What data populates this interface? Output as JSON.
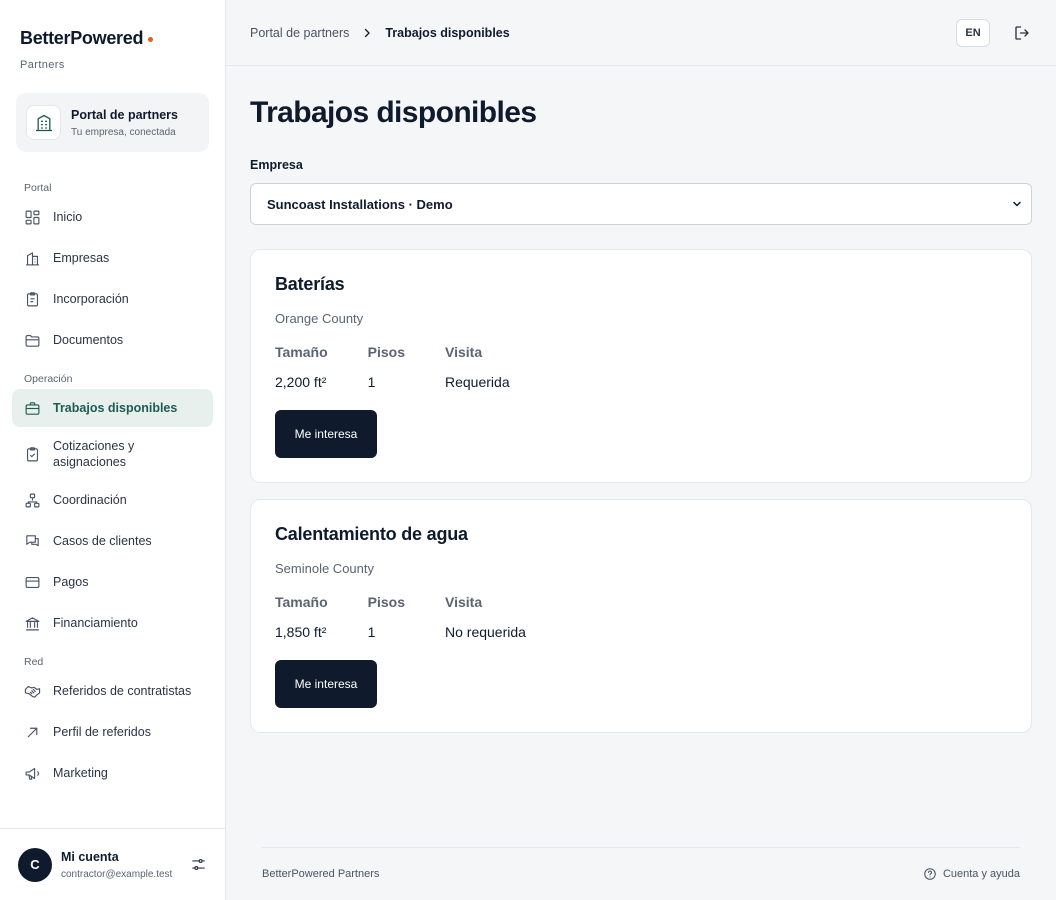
{
  "brand": {
    "name": "BetterPowered",
    "sub": "Partners",
    "dot_color": "#e0601e"
  },
  "portal_card": {
    "title": "Portal de partners",
    "subtitle": "Tu empresa, conectada",
    "icon": "building-icon"
  },
  "nav": {
    "sections": [
      {
        "label": "Portal",
        "items": [
          {
            "label": "Inicio",
            "icon": "dashboard-icon"
          },
          {
            "label": "Empresas",
            "icon": "building-icon"
          },
          {
            "label": "Incorporación",
            "icon": "clipboard-icon"
          },
          {
            "label": "Documentos",
            "icon": "folder-icon"
          }
        ]
      },
      {
        "label": "Operación",
        "items": [
          {
            "label": "Trabajos disponibles",
            "icon": "briefcase-icon",
            "active": true
          },
          {
            "label": "Cotizaciones y asignaciones",
            "icon": "clipboard-check-icon"
          },
          {
            "label": "Coordinación",
            "icon": "network-icon"
          },
          {
            "label": "Casos de clientes",
            "icon": "chat-icon"
          },
          {
            "label": "Pagos",
            "icon": "credit-card-icon"
          },
          {
            "label": "Financiamiento",
            "icon": "bank-icon"
          }
        ]
      },
      {
        "label": "Red",
        "items": [
          {
            "label": "Referidos de contratistas",
            "icon": "handshake-icon"
          },
          {
            "label": "Perfil de referidos",
            "icon": "arrow-up-right-icon"
          },
          {
            "label": "Marketing",
            "icon": "megaphone-icon"
          }
        ]
      }
    ]
  },
  "account": {
    "initial": "C",
    "name": "Mi cuenta",
    "email": "contractor@example.test"
  },
  "topbar": {
    "breadcrumb": {
      "parent": "Portal de partners",
      "current": "Trabajos disponibles"
    },
    "lang": "EN"
  },
  "page": {
    "title": "Trabajos disponibles",
    "company_label": "Empresa",
    "company_selected": "Suncoast Installations · Demo"
  },
  "jobs": [
    {
      "title": "Baterías",
      "county": "Orange County",
      "size_label": "Tamaño",
      "size": "2,200 ft²",
      "floors_label": "Pisos",
      "floors": "1",
      "visit_label": "Visita",
      "visit": "Requerida",
      "button": "Me interesa"
    },
    {
      "title": "Calentamiento de agua",
      "county": "Seminole County",
      "size_label": "Tamaño",
      "size": "1,850 ft²",
      "floors_label": "Pisos",
      "floors": "1",
      "visit_label": "Visita",
      "visit": "No requerida",
      "button": "Me interesa"
    }
  ],
  "footer": {
    "left": "BetterPowered Partners",
    "help": "Cuenta y ayuda"
  },
  "colors": {
    "primary": "#0f1b2d",
    "accent": "#1d5c4c",
    "active_bg": "#e8f0ed"
  }
}
